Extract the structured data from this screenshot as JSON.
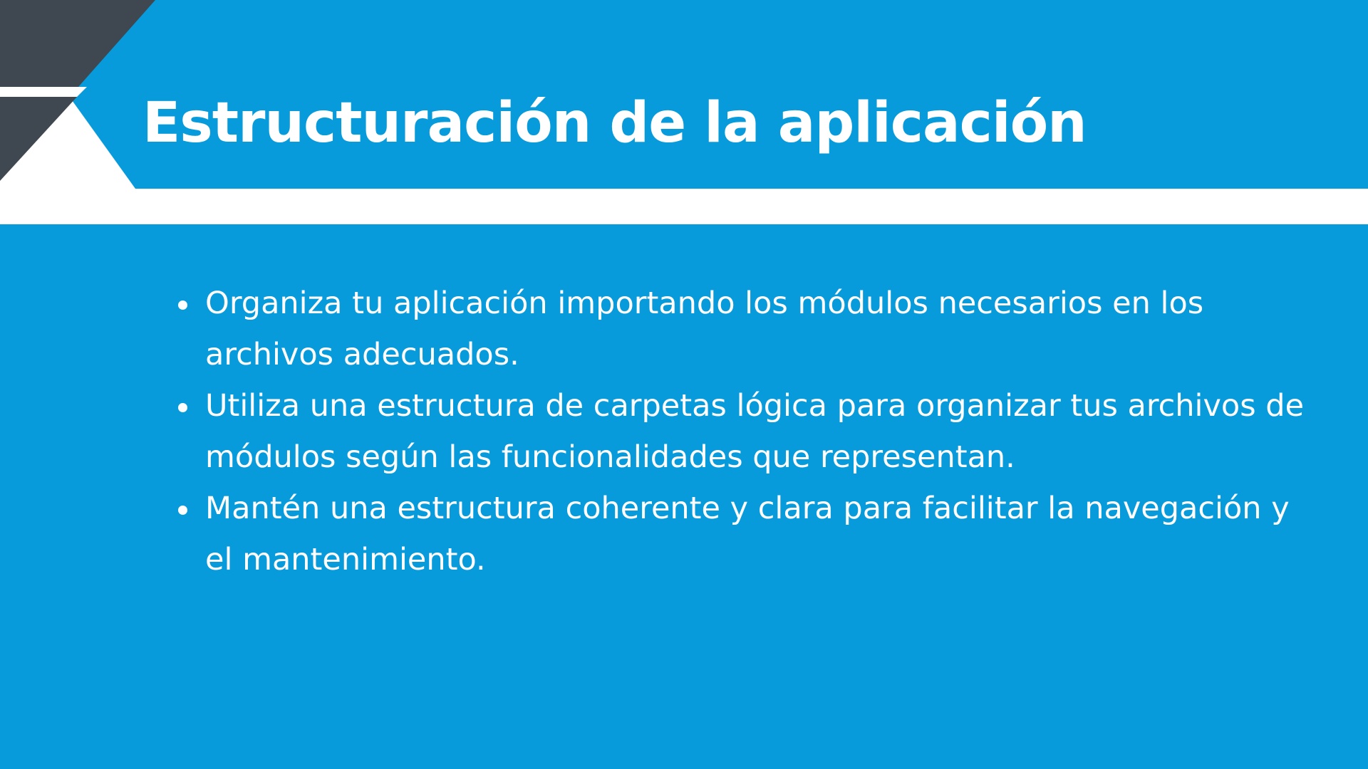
{
  "slide": {
    "title": "Estructuración de la aplicación",
    "bullets": [
      "Organiza tu aplicación importando los módulos necesarios en los archivos adecuados.",
      "Utiliza una estructura de carpetas lógica para organizar tus archivos de módulos según las funcionalidades que representan.",
      "Mantén una estructura coherente y clara para facilitar la navegación y el mantenimiento."
    ]
  },
  "colors": {
    "background_blue": "#079bdc",
    "dark_accent": "#3f4750",
    "text": "#ffffff"
  }
}
